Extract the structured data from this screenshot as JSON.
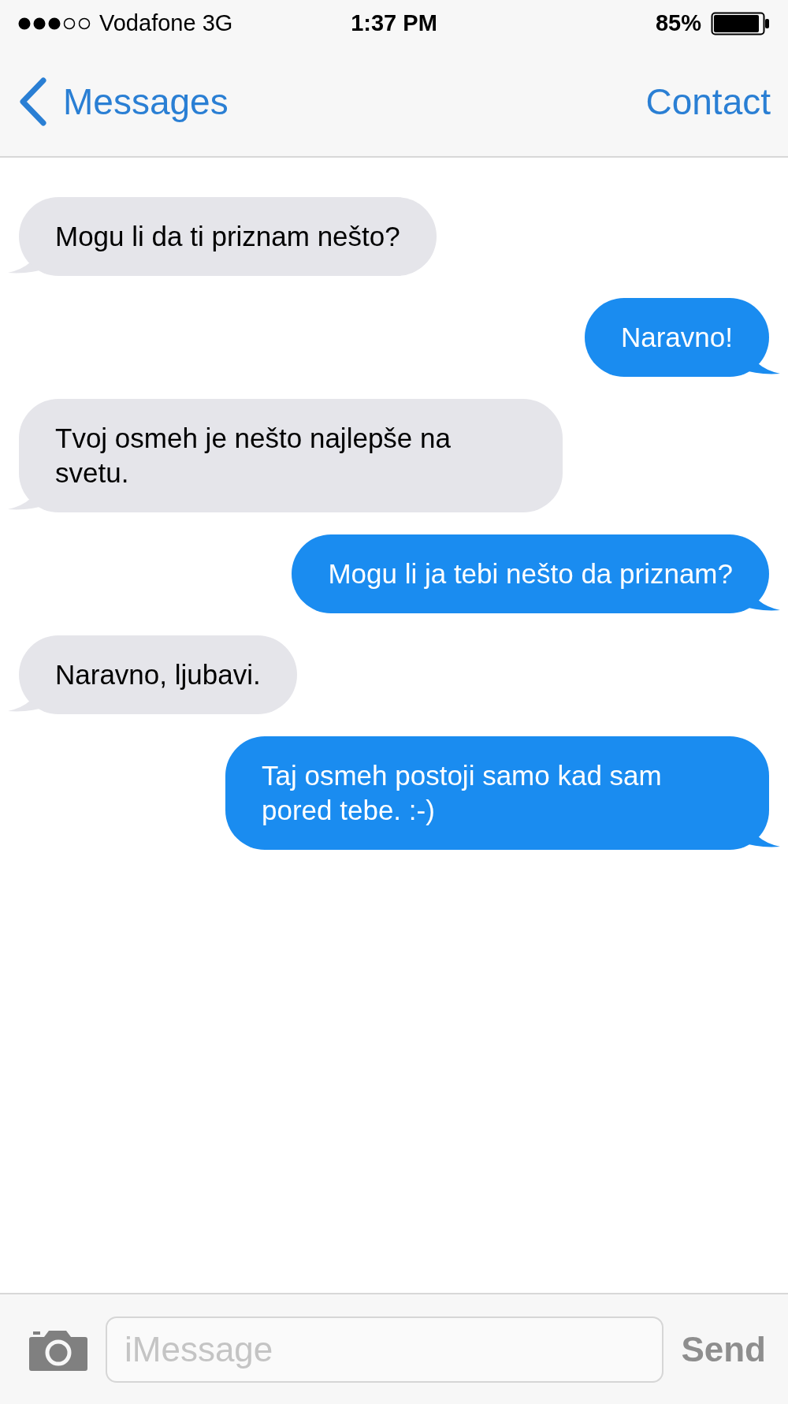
{
  "status_bar": {
    "carrier": "Vodafone 3G",
    "time": "1:37 PM",
    "battery": "85%"
  },
  "nav_bar": {
    "back": "Messages",
    "action": "Contact"
  },
  "messages": [
    {
      "kind": "incoming",
      "text": "Mogu li da ti priznam nešto?"
    },
    {
      "kind": "outgoing",
      "text": "Naravno!"
    },
    {
      "kind": "incoming",
      "text": "Tvoj osmeh je nešto najlepše na svetu."
    },
    {
      "kind": "outgoing",
      "text": "Mogu li ja tebi nešto da priznam?"
    },
    {
      "kind": "incoming",
      "text": "Naravno, ljubavi."
    },
    {
      "kind": "outgoing",
      "text": "Taj osmeh postoji samo kad sam pored tebe. :-)"
    }
  ],
  "composer": {
    "placeholder": "iMessage",
    "send": "Send",
    "send_disabled": true
  }
}
